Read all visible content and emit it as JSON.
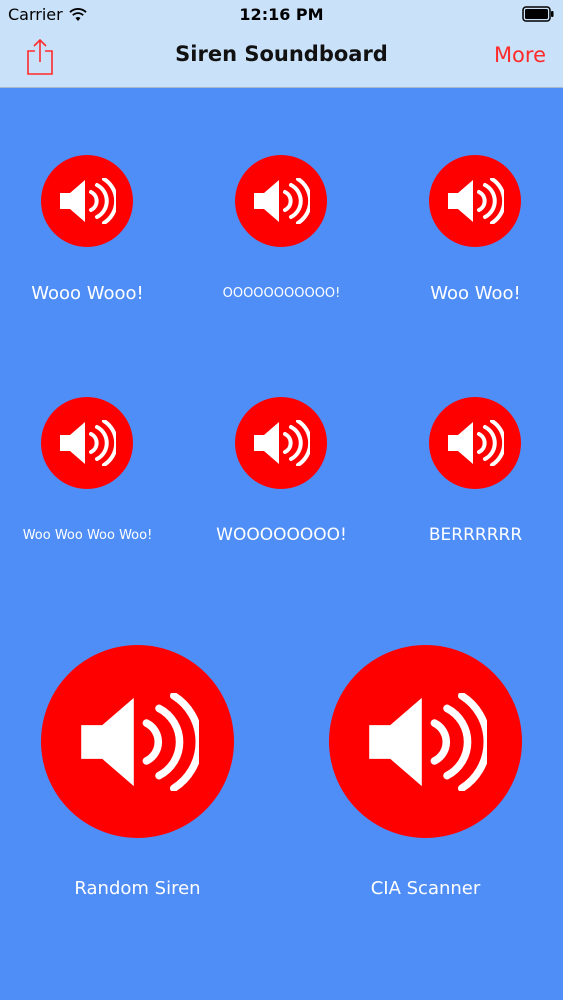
{
  "status_bar": {
    "carrier": "Carrier",
    "time": "12:16 PM"
  },
  "nav": {
    "title": "Siren Soundboard",
    "more_label": "More"
  },
  "sounds": [
    {
      "label": "Wooo Wooo!",
      "icon": "speaker-icon"
    },
    {
      "label": "OOOOOOOOOOO!",
      "icon": "speaker-icon"
    },
    {
      "label": "Woo Woo!",
      "icon": "speaker-icon"
    },
    {
      "label": "Woo Woo Woo Woo!",
      "icon": "speaker-icon"
    },
    {
      "label": "WOOOOOOOO!",
      "icon": "speaker-icon"
    },
    {
      "label": "BERRRRRR",
      "icon": "speaker-icon"
    }
  ],
  "big_sounds": [
    {
      "label": "Random Siren",
      "icon": "speaker-icon"
    },
    {
      "label": "CIA Scanner",
      "icon": "speaker-icon"
    }
  ],
  "colors": {
    "background": "#4f8ef7",
    "bar": "#c9e1f9",
    "button": "#ff0000",
    "accent": "#ff2a2a"
  }
}
